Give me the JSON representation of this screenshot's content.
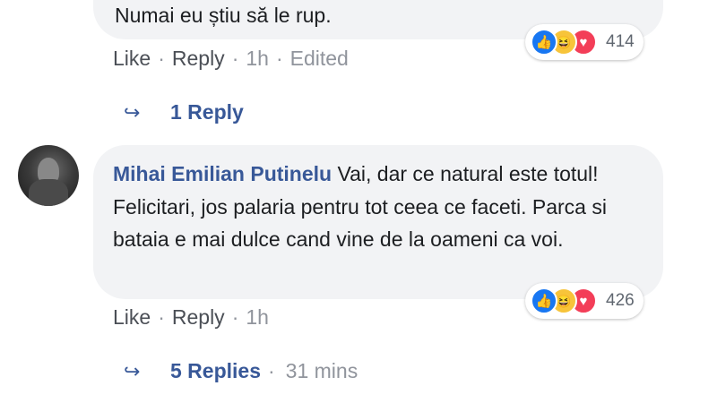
{
  "comment1": {
    "text": "Numai eu știu să le rup.",
    "reaction_count": "414",
    "actions": {
      "like": "Like",
      "reply": "Reply",
      "time": "1h",
      "edited": "Edited"
    },
    "replies": {
      "label": "1 Reply"
    }
  },
  "comment2": {
    "author": "Mihai Emilian Putinelu",
    "text": "Vai, dar ce natural este totul! Felicitari, jos palaria pentru tot ceea ce faceti. Parca si bataia e mai dulce cand vine de la oameni ca voi.",
    "reaction_count": "426",
    "actions": {
      "like": "Like",
      "reply": "Reply",
      "time": "1h"
    },
    "replies": {
      "label": "5 Replies",
      "time": "31 mins"
    }
  },
  "reactions": [
    "like-icon",
    "haha-icon",
    "love-icon"
  ],
  "colors": {
    "link": "#385898",
    "bubble": "#f2f3f5",
    "meta": "#90949c"
  }
}
